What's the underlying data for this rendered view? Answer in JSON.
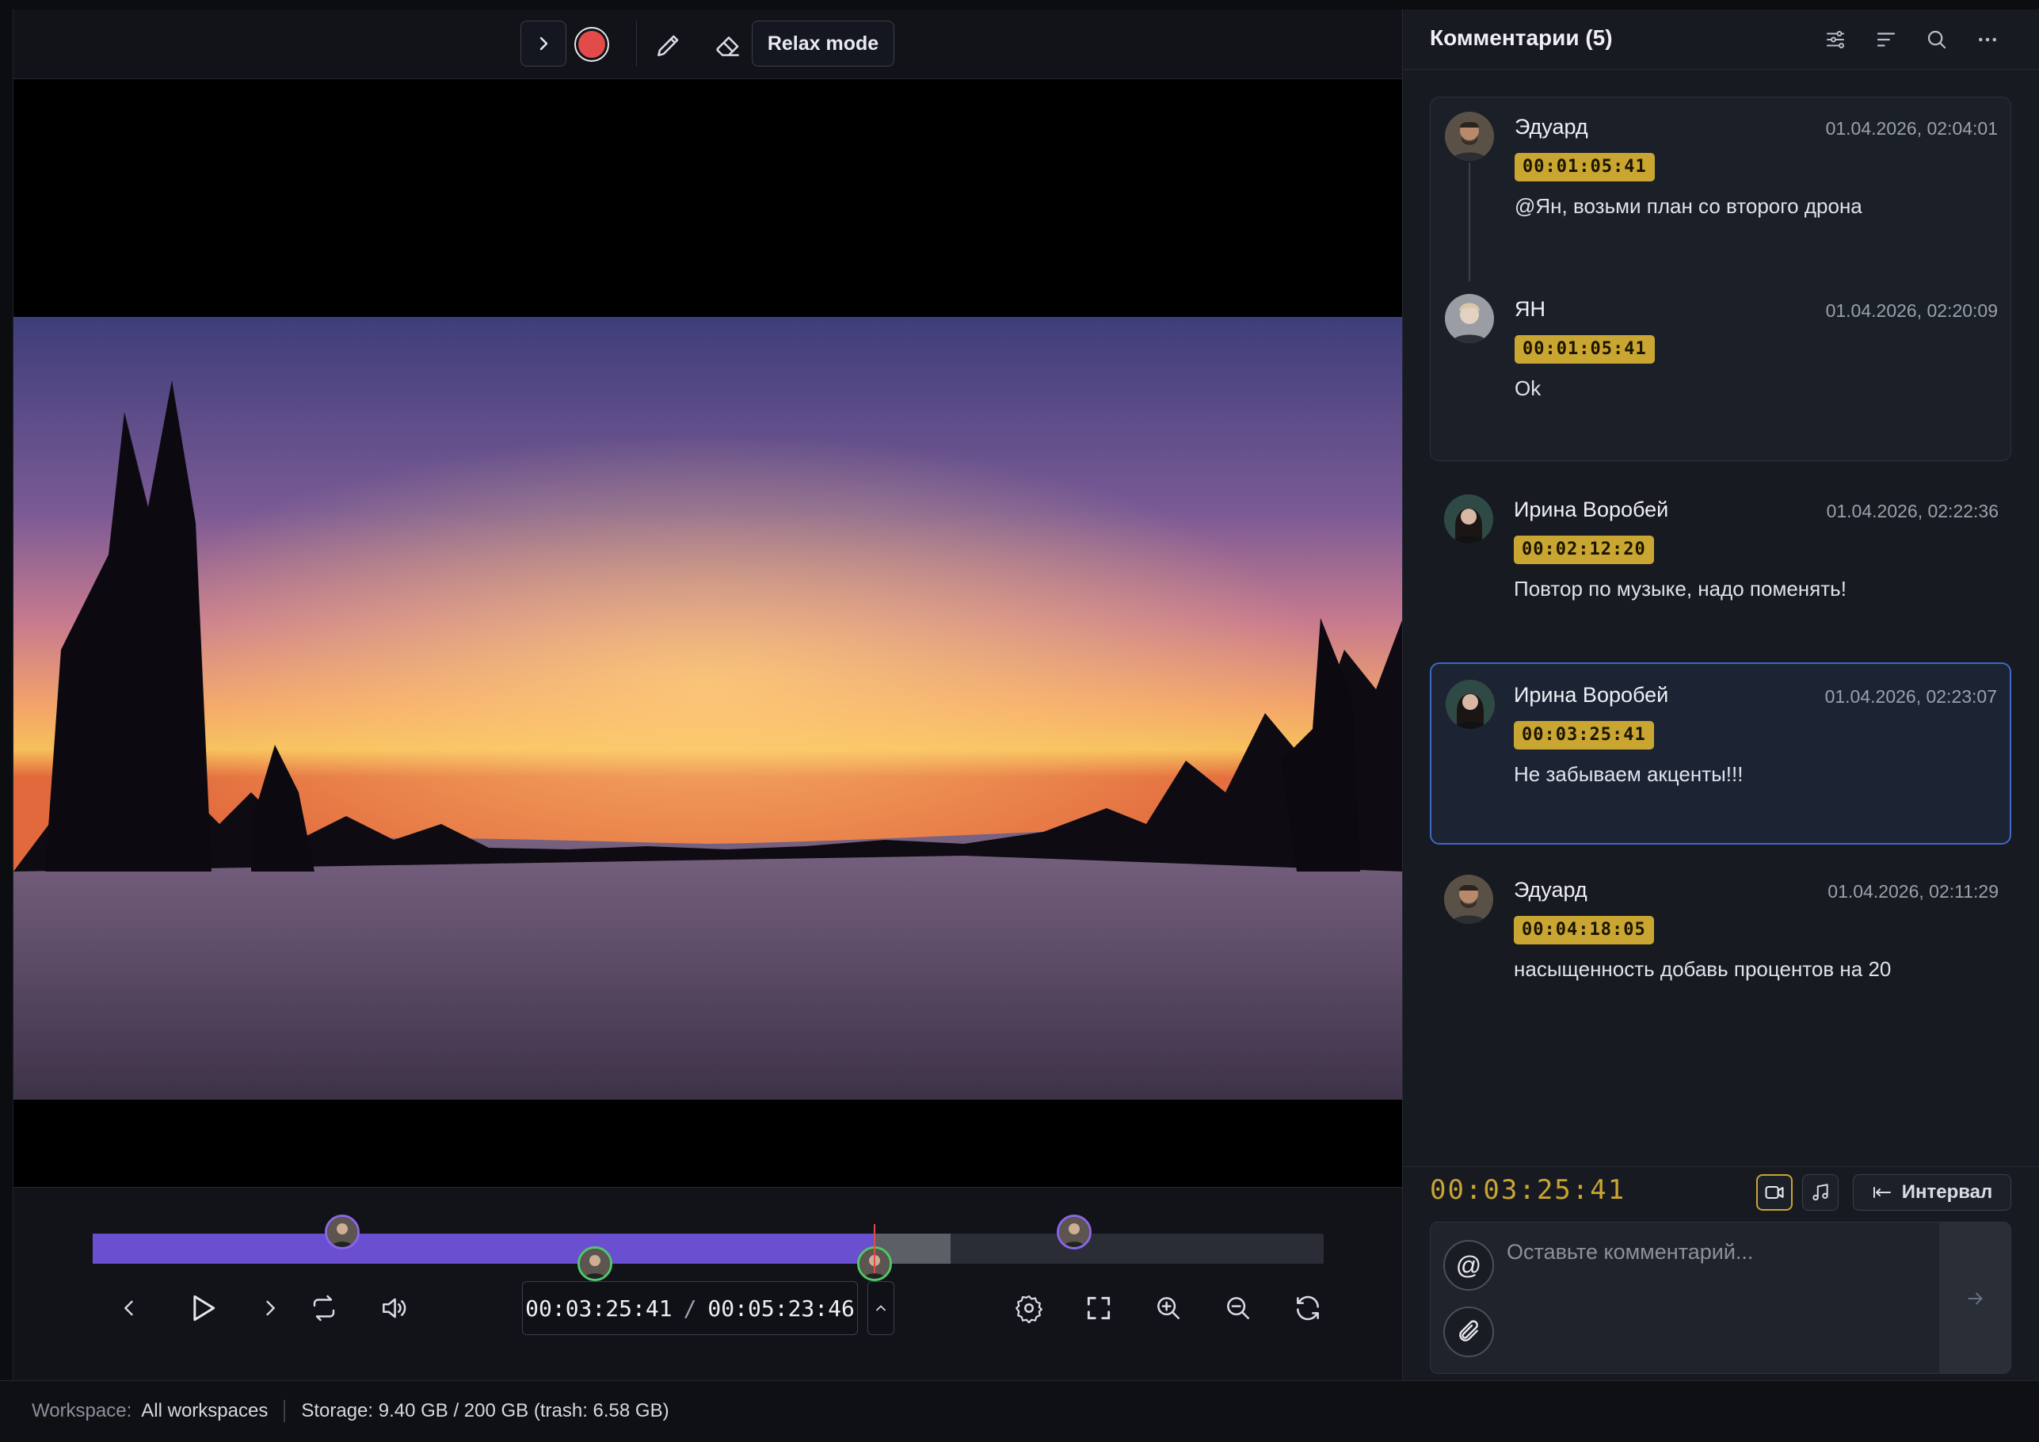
{
  "toolbar": {
    "relax_label": "Relax mode",
    "icons": [
      "chevron-right-icon",
      "record-icon",
      "pencil-icon",
      "eraser-icon"
    ],
    "record_color": "#e34b4b"
  },
  "player": {
    "current_time": "00:03:25:41",
    "separator": "/",
    "total_time": "00:05:23:46",
    "played_fraction": 0.635,
    "buffered_fraction": 0.697,
    "markers": [
      {
        "at": 0.203,
        "row": "top",
        "ring": "purple",
        "author": "ЯН"
      },
      {
        "at": 0.408,
        "row": "bottom",
        "ring": "green",
        "author": "Ирина Воробей"
      },
      {
        "at": 0.635,
        "row": "bottom",
        "ring": "green",
        "author": "Ирина Воробей"
      },
      {
        "at": 0.797,
        "row": "top",
        "ring": "purple",
        "author": "Эдуард"
      }
    ],
    "controls": [
      "prev-icon",
      "play-icon",
      "next-icon",
      "loop-icon",
      "volume-icon"
    ],
    "tools": [
      "settings-icon",
      "fullscreen-icon",
      "zoom-in-icon",
      "zoom-out-icon",
      "refresh-icon"
    ],
    "accent": "#6a4fd0"
  },
  "panel": {
    "title": "Комментарии (5)",
    "header_icons": [
      "filter-icon",
      "sort-icon",
      "search-icon",
      "more-icon"
    ],
    "thread": [
      {
        "author": "Эдуард",
        "date": "01.04.2026, 02:04:01",
        "timecode": "00:01:05:41",
        "text": "@Ян, возьми план со второго дрона"
      },
      {
        "author": "ЯН",
        "date": "01.04.2026, 02:20:09",
        "timecode": "00:01:05:41",
        "text": "Ok"
      }
    ],
    "comments": [
      {
        "author": "Ирина Воробей",
        "date": "01.04.2026, 02:22:36",
        "timecode": "00:02:12:20",
        "text": "Повтор по музыке, надо поменять!"
      },
      {
        "author": "Ирина Воробей",
        "date": "01.04.2026, 02:23:07",
        "timecode": "00:03:25:41",
        "text": "Не забываем акценты!!!"
      },
      {
        "author": "Эдуард",
        "date": "01.04.2026, 02:11:29",
        "timecode": "00:04:18:05",
        "text": "насыщенность добавь процентов на 20"
      }
    ],
    "timecode_color": "#c9a531",
    "composer": {
      "current_timecode": "00:03:25:41",
      "interval_label": "Интервал",
      "placeholder": "Оставьте комментарий...",
      "mention_glyph": "@"
    }
  },
  "status": {
    "workspace_label": "Workspace:",
    "workspace_value": "All workspaces",
    "storage_text": "Storage: 9.40 GB / 200 GB (trash: 6.58 GB)"
  }
}
